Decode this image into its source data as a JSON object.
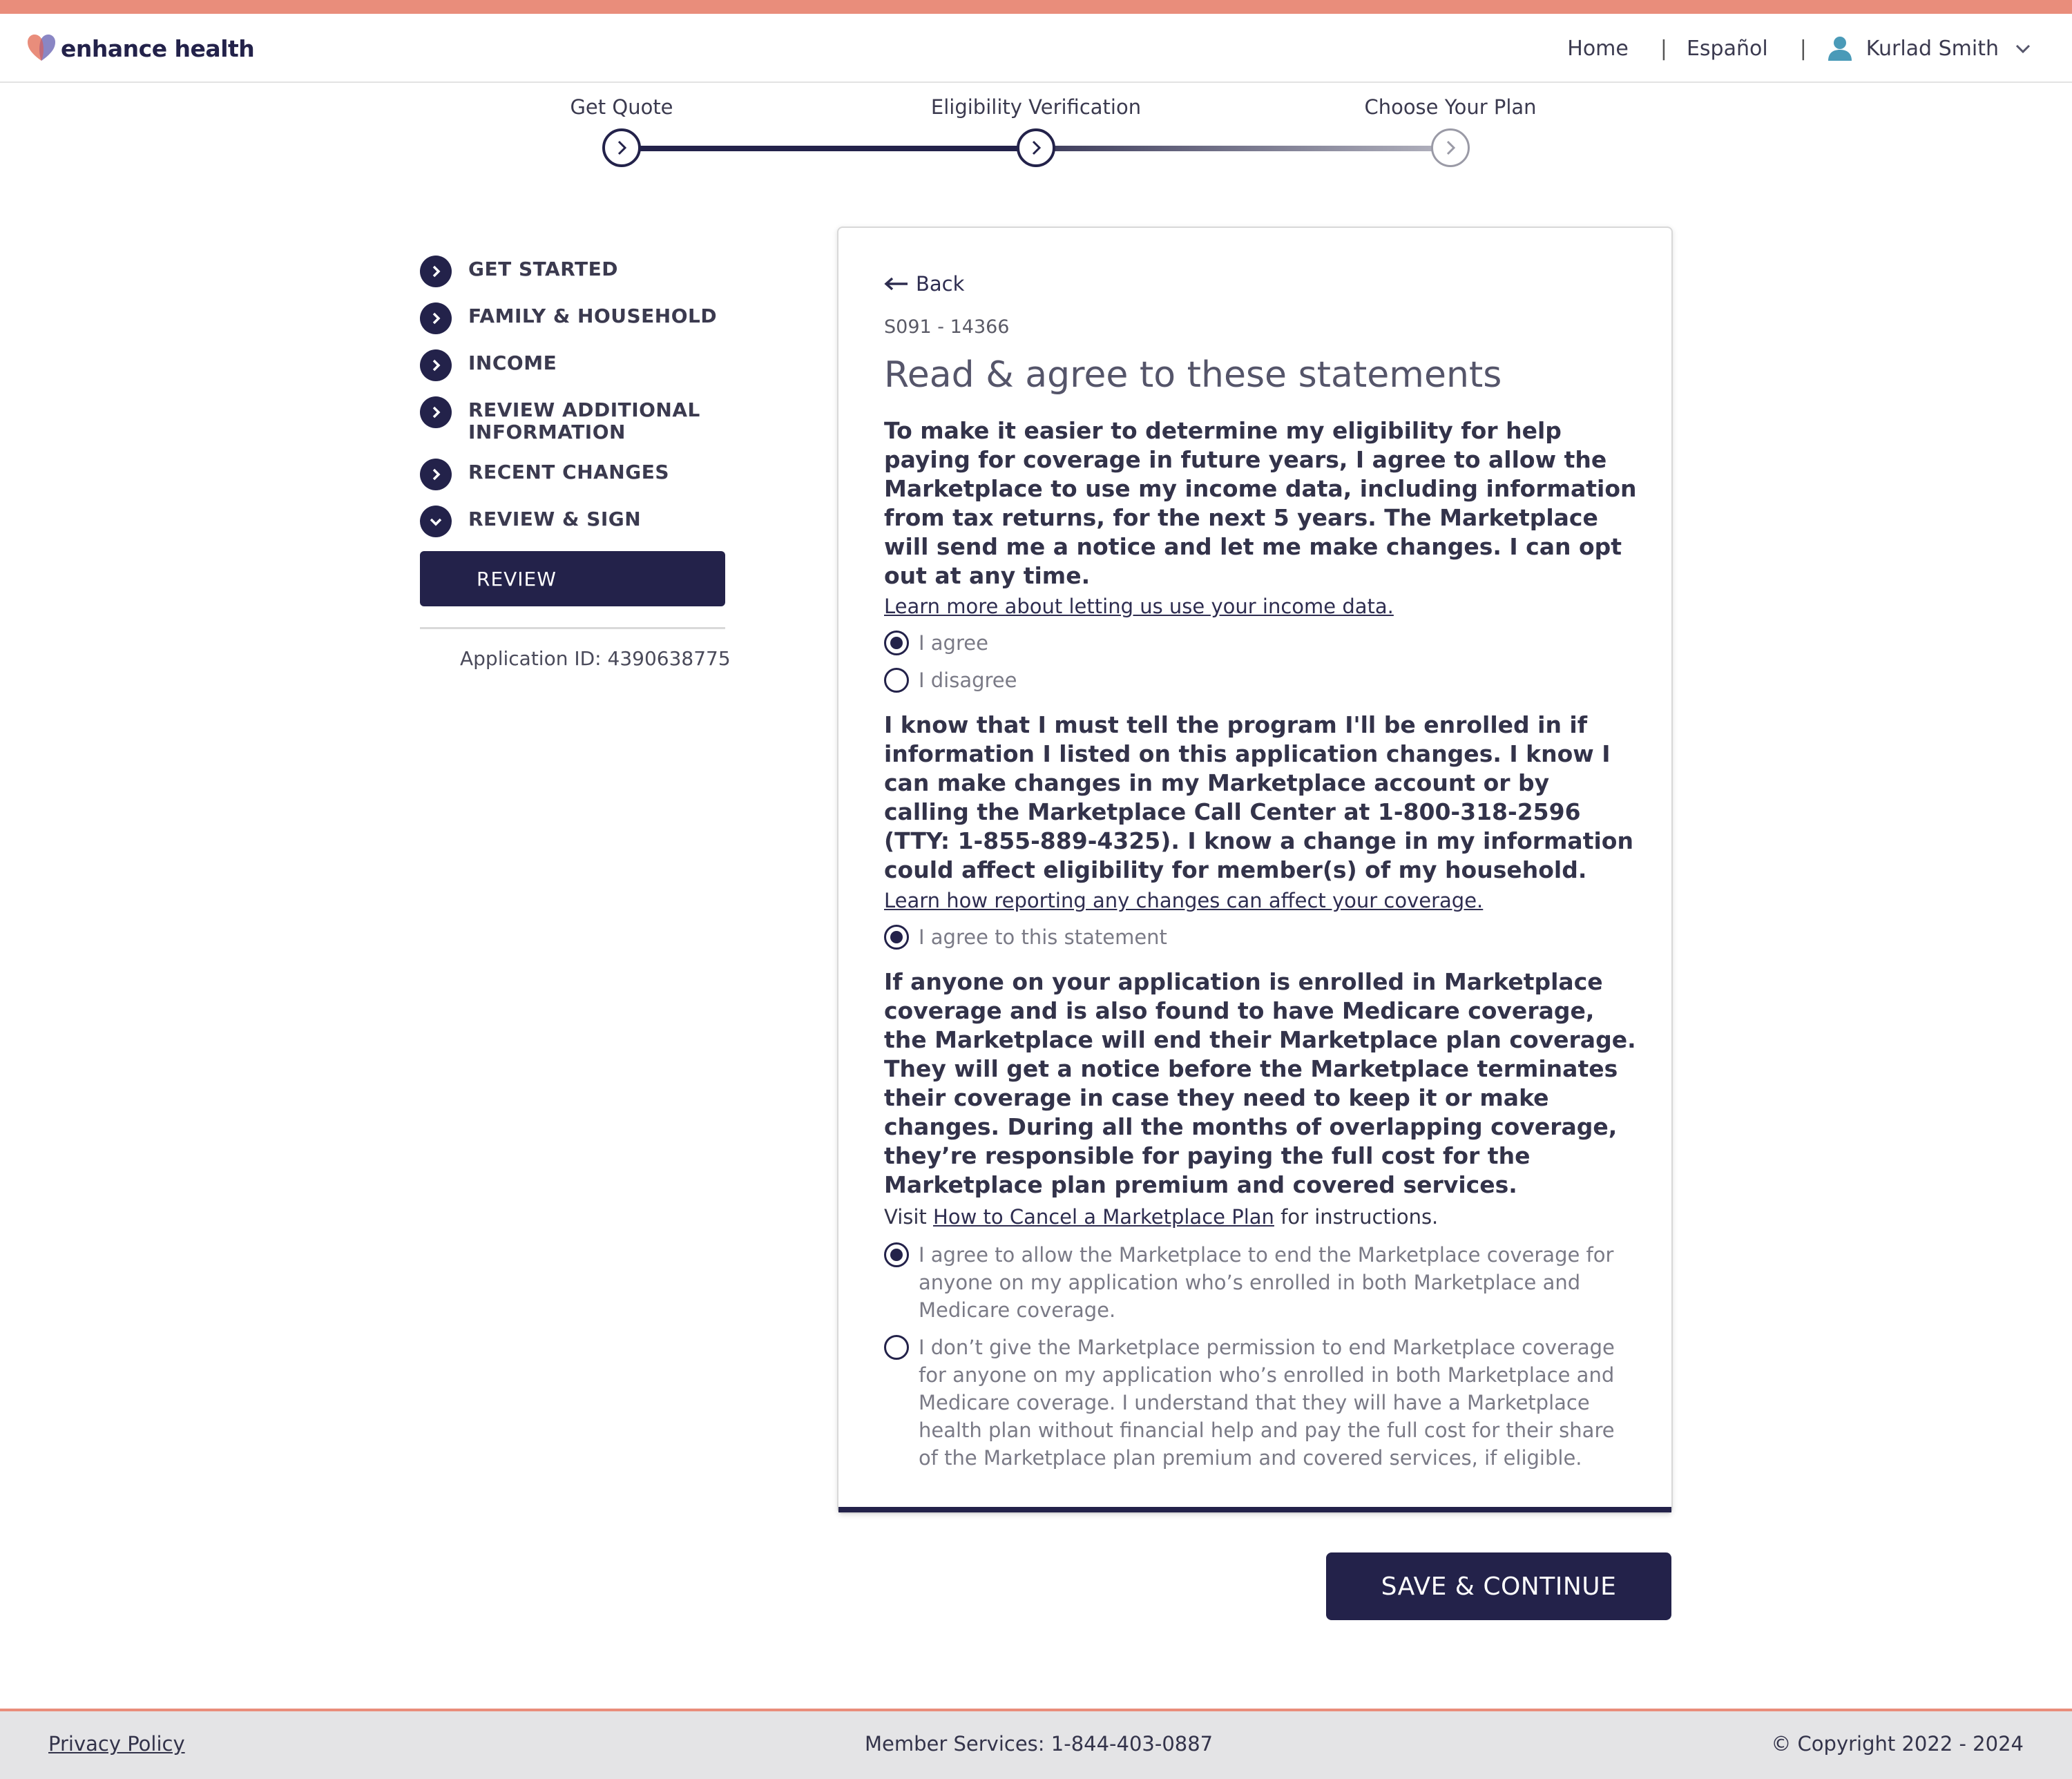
{
  "header": {
    "logo_text": "enhance health",
    "nav": {
      "home": "Home",
      "lang": "Español",
      "user": "Kurlad Smith",
      "separator": "|"
    }
  },
  "stepper": {
    "steps": [
      {
        "label": "Get Quote",
        "state": "complete"
      },
      {
        "label": "Eligibility Verification",
        "state": "current"
      },
      {
        "label": "Choose Your Plan",
        "state": "upcoming"
      }
    ]
  },
  "sidebar": {
    "items": [
      {
        "label": "GET STARTED"
      },
      {
        "label": "FAMILY & HOUSEHOLD"
      },
      {
        "label": "INCOME"
      },
      {
        "label": "REVIEW ADDITIONAL INFORMATION"
      },
      {
        "label": "RECENT CHANGES"
      },
      {
        "label": "REVIEW & SIGN"
      }
    ],
    "review_button": "REVIEW",
    "application_id": "Application ID: 4390638775"
  },
  "card": {
    "back": "Back",
    "code": "S091 - 14366",
    "title": "Read & agree to these statements",
    "statement1": "To make it easier to determine my eligibility for help paying for coverage in future years, I agree to allow the Marketplace to use my income data, including information from tax returns, for the next 5 years. The Marketplace will send me a notice and let me make changes. I can opt out at any time.",
    "link1": "Learn more about letting us use your income data.",
    "s1_options": [
      "I agree",
      "I disagree"
    ],
    "statement2": "I know that I must tell the program I'll be enrolled in if information I listed on this application changes. I know I can make changes in my Marketplace account or by calling the Marketplace Call Center at 1-800-318-2596 (TTY: 1-855-889-4325). I know a change in my information could affect eligibility for member(s) of my household.",
    "link2": "Learn how reporting any changes can affect your coverage.",
    "s2_option": "I agree to this statement",
    "statement3": "If anyone on your application is enrolled in Marketplace coverage and is also found to have Medicare coverage, the Marketplace will end their Marketplace plan coverage. They will get a notice before the Marketplace terminates their coverage in case they need to keep it or make changes. During all the months of overlapping coverage, they’re responsible for paying the full cost for the Marketplace plan premium and covered services.",
    "visit_prefix": "Visit",
    "visit_link": "How to Cancel a Marketplace Plan",
    "visit_suffix": "for instructions.",
    "s3_options": [
      "I agree to allow the Marketplace to end the Marketplace coverage for anyone on my application who’s enrolled in both Marketplace and Medicare coverage.",
      "I don’t give the Marketplace permission to end Marketplace coverage for anyone on my application who’s enrolled in both Marketplace and Medicare coverage. I understand that they will have a Marketplace health plan without financial help and pay the full cost for their share of the Marketplace plan premium and covered services, if eligible."
    ]
  },
  "save_button": "SAVE & CONTINUE",
  "footer": {
    "privacy": "Privacy Policy",
    "member_services": "Member Services: 1-844-403-0887",
    "copyright": "© Copyright 2022 - 2024"
  },
  "colors": {
    "brand": "#23224a",
    "accent": "#e98d7b",
    "footer_bg": "#e4e4e6"
  }
}
